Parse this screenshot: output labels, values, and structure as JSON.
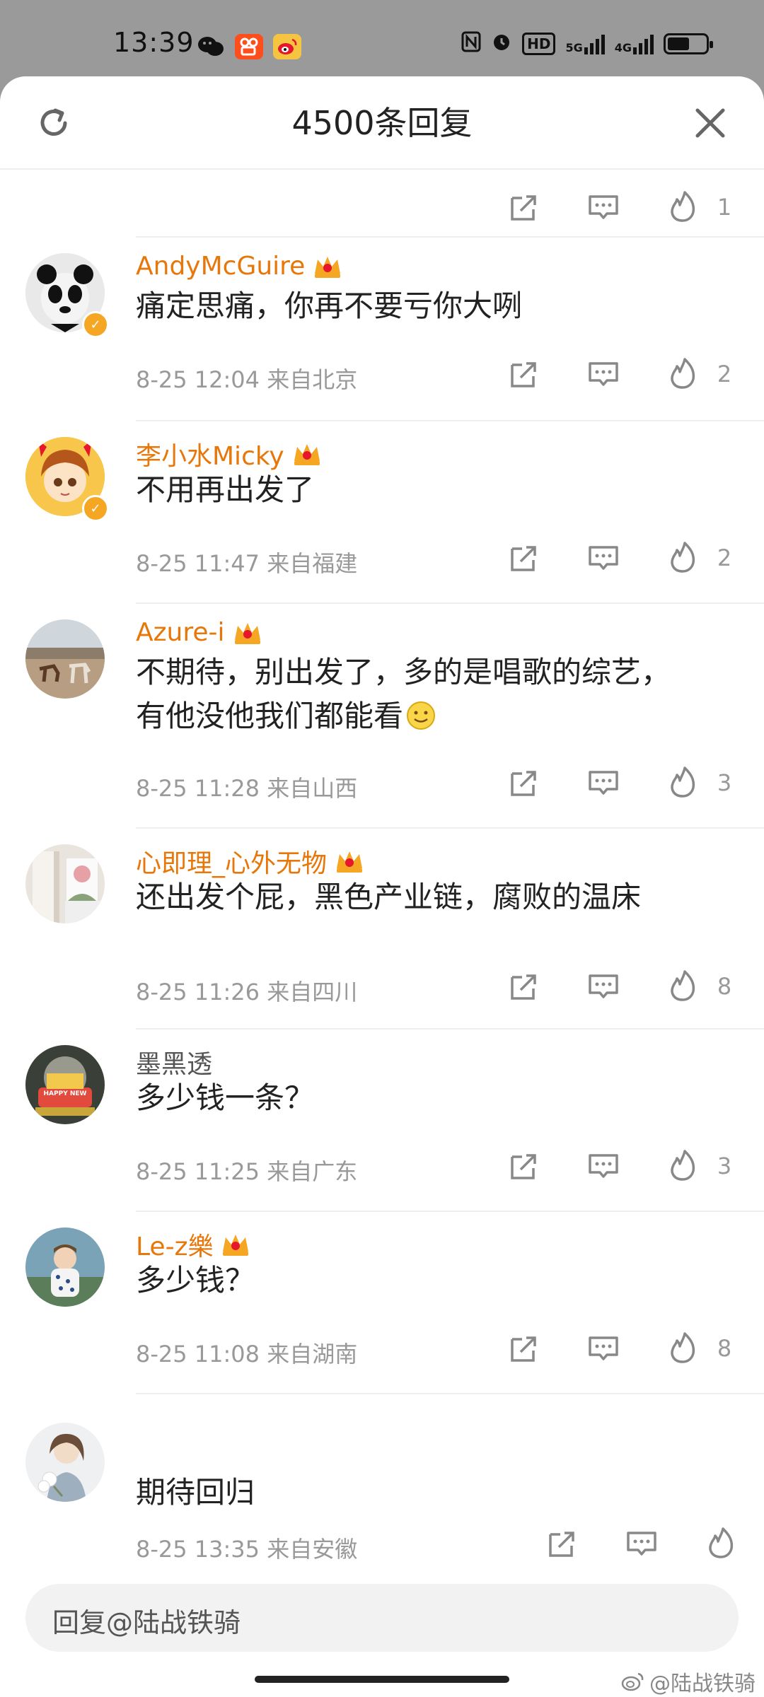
{
  "status_bar": {
    "time": "13:39",
    "apps": [
      "wechat-icon",
      "kuaishou-icon",
      "weibo-icon"
    ],
    "indicators": [
      "nfc-icon",
      "alarm-icon",
      "HD",
      "5G",
      "4G"
    ],
    "battery_level": 0.55
  },
  "header": {
    "title": "4500条回复",
    "refresh_icon": "refresh-icon",
    "close_icon": "close-icon"
  },
  "top_row": {
    "likes": "1"
  },
  "comments": [
    {
      "user": "AndyMcGuire",
      "vip": true,
      "verified": true,
      "text": "痛定思痛，你再不要亏你大咧",
      "date": "8-25 12:04",
      "location": "来自北京",
      "likes": "2"
    },
    {
      "user": "李小水Micky",
      "vip": true,
      "verified": true,
      "text": "不用再出发了",
      "date": "8-25 11:47",
      "location": "来自福建",
      "likes": "2"
    },
    {
      "user": "Azure-i",
      "vip": true,
      "verified": false,
      "text_line1": "不期待，别出发了，多的是唱歌的综艺，",
      "text_line2": "有他没他我们都能看",
      "date": "8-25 11:28",
      "location": "来自山西",
      "likes": "3"
    },
    {
      "user": "心即理_心外无物",
      "vip": true,
      "verified": false,
      "text": "还出发个屁，黑色产业链，腐败的温床",
      "date": "8-25 11:26",
      "location": "来自四川",
      "likes": "8"
    },
    {
      "user": "墨黑透",
      "vip": false,
      "verified": false,
      "text": "多少钱一条？",
      "date": "8-25 11:25",
      "location": "来自广东",
      "likes": "3"
    },
    {
      "user": "Le-z樂",
      "vip": true,
      "verified": false,
      "text": "多少钱？",
      "date": "8-25 11:08",
      "location": "来自湖南",
      "likes": "8"
    },
    {
      "user": "",
      "vip": false,
      "verified": false,
      "text": "期待回归",
      "date": "8-25 13:35",
      "location": "来自安徽",
      "likes": ""
    }
  ],
  "reply_input": {
    "placeholder": "回复@陆战铁骑"
  },
  "avatar_badges": {
    "happy_new": "HAPPY NEW"
  },
  "watermark": "@陆战铁骑",
  "colors": {
    "username": "#e8770a",
    "meta": "#999999",
    "vip_crown": "#f5a623"
  }
}
